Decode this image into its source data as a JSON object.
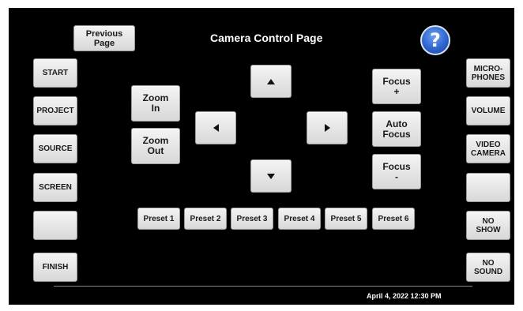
{
  "header": {
    "previous_page_label": "Previous\nPage",
    "title": "Camera Control Page",
    "help_label": "?"
  },
  "left_menu": {
    "start": "START",
    "project": "PROJECT",
    "source": "SOURCE",
    "screen": "SCREEN",
    "blank": "",
    "finish": "FINISH"
  },
  "right_menu": {
    "microphones": "MICRO-\nPHONES",
    "volume": "VOLUME",
    "video_camera": "VIDEO\nCAMERA",
    "blank": "",
    "no_show": "NO\nSHOW",
    "no_sound": "NO\nSOUND"
  },
  "zoom": {
    "in_label": "Zoom\nIn",
    "out_label": "Zoom\nOut"
  },
  "focus": {
    "plus_label": "Focus\n+",
    "auto_label": "Auto\nFocus",
    "minus_label": "Focus\n-"
  },
  "presets": [
    "Preset 1",
    "Preset 2",
    "Preset 3",
    "Preset 4",
    "Preset 5",
    "Preset 6"
  ],
  "footer": {
    "datetime": "April 4, 2022 12:30 PM"
  },
  "colors": {
    "background": "#000000",
    "button_face": "#e6e6e6",
    "help_blue": "#2f64cf"
  },
  "icons": {
    "pan_up": "triangle-up",
    "pan_down": "triangle-down",
    "pan_left": "triangle-left",
    "pan_right": "triangle-right",
    "help": "question-mark-circle"
  }
}
